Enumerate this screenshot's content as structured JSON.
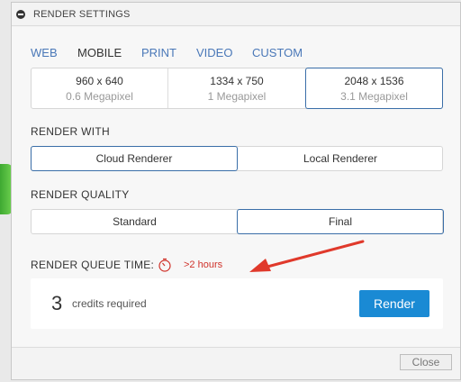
{
  "window": {
    "title": "RENDER SETTINGS"
  },
  "tabs": [
    {
      "label": "WEB",
      "active": false
    },
    {
      "label": "MOBILE",
      "active": true
    },
    {
      "label": "PRINT",
      "active": false
    },
    {
      "label": "VIDEO",
      "active": false
    },
    {
      "label": "CUSTOM",
      "active": false
    }
  ],
  "resolutions": [
    {
      "size": "960 x 640",
      "megapixels": "0.6 Megapixel",
      "selected": false
    },
    {
      "size": "1334 x 750",
      "megapixels": "1 Megapixel",
      "selected": false
    },
    {
      "size": "2048 x 1536",
      "megapixels": "3.1 Megapixel",
      "selected": true
    }
  ],
  "render_with": {
    "label": "RENDER WITH",
    "options": [
      {
        "label": "Cloud Renderer",
        "selected": true
      },
      {
        "label": "Local Renderer",
        "selected": false
      }
    ]
  },
  "render_quality": {
    "label": "RENDER QUALITY",
    "options": [
      {
        "label": "Standard",
        "selected": false
      },
      {
        "label": "Final",
        "selected": true
      }
    ]
  },
  "queue": {
    "label": "RENDER QUEUE TIME:",
    "value": ">2 hours",
    "icon": "timer-icon"
  },
  "credits": {
    "count": "3",
    "text": "credits required"
  },
  "buttons": {
    "render": "Render",
    "close": "Close"
  },
  "colors": {
    "accent": "#1a8ad4",
    "tab_link": "#4a78b8",
    "selected_border": "#3a6ea8",
    "warning": "#d0332b",
    "annotation_arrow": "#e0392b"
  }
}
